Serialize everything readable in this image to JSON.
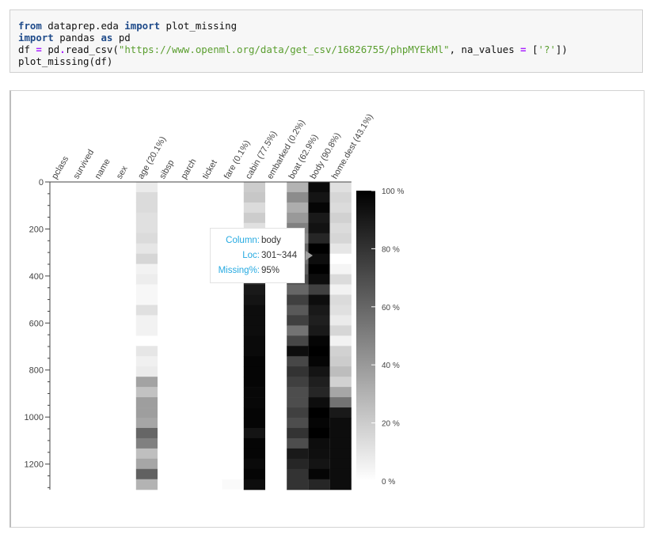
{
  "code": {
    "lines": [
      [
        {
          "t": "from",
          "c": "kw"
        },
        {
          "t": " dataprep.eda ",
          "c": ""
        },
        {
          "t": "import",
          "c": "kw"
        },
        {
          "t": " plot_missing",
          "c": ""
        }
      ],
      [
        {
          "t": "import",
          "c": "kw"
        },
        {
          "t": " pandas ",
          "c": ""
        },
        {
          "t": "as",
          "c": "kw"
        },
        {
          "t": " pd",
          "c": ""
        }
      ],
      [
        {
          "t": "df ",
          "c": ""
        },
        {
          "t": "=",
          "c": "op"
        },
        {
          "t": " pd",
          "c": ""
        },
        {
          "t": ".",
          "c": "op"
        },
        {
          "t": "read_csv(",
          "c": ""
        },
        {
          "t": "\"https://www.openml.org/data/get_csv/16826755/phpMYEkMl\"",
          "c": "str"
        },
        {
          "t": ", na_values ",
          "c": ""
        },
        {
          "t": "=",
          "c": "op"
        },
        {
          "t": " [",
          "c": ""
        },
        {
          "t": "'?'",
          "c": "str"
        },
        {
          "t": "])",
          "c": ""
        }
      ],
      [
        {
          "t": "plot_missing(df)",
          "c": ""
        }
      ]
    ]
  },
  "tooltip": {
    "column_key": "Column:",
    "column_val": "body",
    "loc_key": "Loc:",
    "loc_val": "301~344",
    "missing_key": "Missing%:",
    "missing_val": "95%"
  },
  "chart_data": {
    "type": "heatmap",
    "title": "",
    "xlabel": "",
    "ylabel": "",
    "columns": [
      "pclass",
      "survived",
      "name",
      "sex",
      "age (20.1%)",
      "sibsp",
      "parch",
      "ticket",
      "fare (0.1%)",
      "cabin (77.5%)",
      "embarked (0.2%)",
      "boat (62.9%)",
      "body (90.8%)",
      "home.dest (43.1%)"
    ],
    "y_ticks": [
      0,
      200,
      400,
      600,
      800,
      1000,
      1200
    ],
    "ylim": [
      0,
      1309
    ],
    "bin_size": 43.6,
    "colorbar": {
      "labels": [
        "100 %",
        "80 %",
        "60 %",
        "40 %",
        "20 %",
        "0 %"
      ],
      "range": [
        0,
        100
      ]
    },
    "missing_pct_by_bin": {
      "age (20.1%)": [
        8,
        14,
        14,
        12,
        12,
        14,
        10,
        16,
        5,
        7,
        3,
        3,
        12,
        5,
        5,
        0,
        10,
        6,
        8,
        36,
        24,
        38,
        38,
        35,
        60,
        50,
        25,
        35,
        62,
        30,
        25,
        35
      ],
      "fare (0.1%)": [
        0,
        0,
        0,
        0,
        0,
        0,
        0,
        0,
        0,
        0,
        0,
        0,
        0,
        0,
        0,
        0,
        0,
        0,
        0,
        0,
        0,
        0,
        0,
        0,
        0,
        0,
        0,
        0,
        0,
        2,
        0,
        0
      ],
      "cabin (77.5%)": [
        20,
        22,
        14,
        20,
        12,
        18,
        30,
        45,
        78,
        80,
        90,
        92,
        95,
        95,
        95,
        96,
        96,
        98,
        98,
        98,
        97,
        97,
        98,
        98,
        92,
        98,
        98,
        96,
        98,
        95,
        98,
        98
      ],
      "embarked (0.2%)": [
        0,
        0,
        0,
        0,
        0,
        4,
        0,
        0,
        0,
        0,
        0,
        0,
        0,
        0,
        0,
        0,
        0,
        0,
        0,
        0,
        0,
        0,
        0,
        0,
        0,
        0,
        0,
        0,
        0,
        0,
        0,
        0
      ],
      "boat (62.9%)": [
        30,
        45,
        32,
        40,
        50,
        45,
        60,
        55,
        62,
        70,
        60,
        75,
        65,
        75,
        55,
        72,
        95,
        72,
        80,
        75,
        70,
        70,
        75,
        70,
        80,
        70,
        90,
        85,
        80,
        80,
        86,
        96
      ],
      "body (90.8%)": [
        96,
        92,
        98,
        90,
        93,
        85,
        100,
        95,
        100,
        95,
        75,
        95,
        90,
        88,
        90,
        98,
        100,
        98,
        92,
        88,
        85,
        95,
        100,
        98,
        100,
        95,
        94,
        92,
        98,
        85,
        92,
        80
      ],
      "home.dest (43.1%)": [
        12,
        16,
        14,
        18,
        14,
        16,
        10,
        0,
        4,
        14,
        5,
        14,
        12,
        8,
        16,
        5,
        18,
        20,
        26,
        18,
        35,
        55,
        90,
        95,
        95,
        95,
        95,
        95,
        95,
        95,
        95,
        95
      ]
    }
  }
}
